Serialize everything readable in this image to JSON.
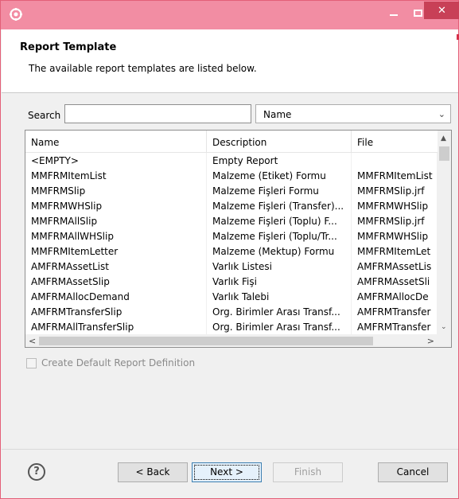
{
  "window": {
    "app_icon": "gear-icon",
    "controls": [
      "minimize-icon",
      "maximize-icon",
      "close-icon"
    ],
    "close_glyph": "✕",
    "titlebar_color": "#f28da3",
    "close_color": "#c84057"
  },
  "header": {
    "title": "Report Template",
    "description": "The available report templates are listed below."
  },
  "search": {
    "label": "Search",
    "value": "",
    "filter_selected": "Name",
    "chevron": "⌄"
  },
  "table": {
    "columns": [
      "Name",
      "Description",
      "File"
    ],
    "rows": [
      [
        "<EMPTY>",
        "Empty Report",
        ""
      ],
      [
        "MMFRMItemList",
        "Malzeme (Etiket) Formu",
        "MMFRMItemList"
      ],
      [
        "MMFRMSlip",
        "Malzeme Fişleri Formu",
        "MMFRMSlip.jrf"
      ],
      [
        "MMFRMWHSlip",
        "Malzeme Fişleri (Transfer)...",
        "MMFRMWHSlip"
      ],
      [
        "MMFRMAllSlip",
        "Malzeme Fişleri (Toplu) F...",
        "MMFRMSlip.jrf"
      ],
      [
        "MMFRMAllWHSlip",
        "Malzeme Fişleri (Toplu/Tr...",
        "MMFRMWHSlip"
      ],
      [
        "MMFRMItemLetter",
        "Malzeme (Mektup) Formu",
        "MMFRMItemLet"
      ],
      [
        "AMFRMAssetList",
        "Varlık Listesi",
        "AMFRMAssetLis"
      ],
      [
        "AMFRMAssetSlip",
        "Varlık Fişi",
        "AMFRMAssetSli"
      ],
      [
        "AMFRMAllocDemand",
        "Varlık Talebi",
        "AMFRMAllocDe"
      ],
      [
        "AMFRMTransferSlip",
        "Org. Birimler Arası Transf...",
        "AMFRMTransfer"
      ],
      [
        "AMFRMAllTransferSlip",
        "Org. Birimler Arası Transf...",
        "AMFRMTransfer"
      ]
    ],
    "scroll_glyphs": {
      "up": "▲",
      "down": "⌄",
      "left": "<",
      "right": ">"
    }
  },
  "options": {
    "create_default_label": "Create Default Report Definition",
    "create_default_checked": false
  },
  "footer": {
    "help_glyph": "?",
    "back_label": "< Back",
    "next_label": "Next >",
    "finish_label": "Finish",
    "cancel_label": "Cancel"
  }
}
